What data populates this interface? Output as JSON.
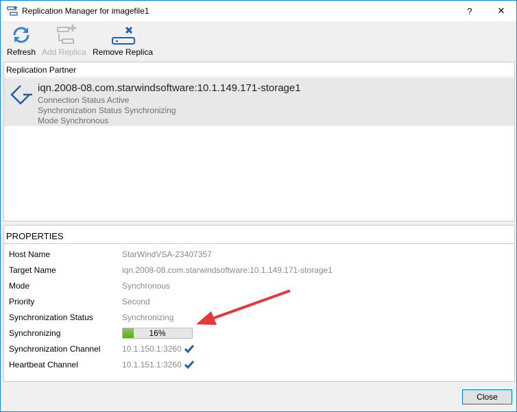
{
  "window": {
    "title": "Replication Manager for imagefile1",
    "help": "?",
    "close": "✕"
  },
  "toolbar": {
    "refresh": "Refresh",
    "add_replica": "Add Replica",
    "remove_replica": "Remove Replica"
  },
  "partners": {
    "header": "Replication Partner",
    "items": [
      {
        "name": "iqn.2008-08.com.starwindsoftware:10.1.149.171-storage1",
        "connection": "Connection Status Active",
        "sync": "Synchronization Status Synchronizing",
        "mode": "Mode Synchronous"
      }
    ]
  },
  "properties": {
    "title": "PROPERTIES",
    "rows": [
      {
        "k": "Host Name",
        "v": "StarWindVSA-23407357"
      },
      {
        "k": "Target Name",
        "v": "iqn.2008-08.com.starwindsoftware:10.1.149.171-storage1"
      },
      {
        "k": "Mode",
        "v": "Synchronous"
      },
      {
        "k": "Priority",
        "v": "Second"
      },
      {
        "k": "Synchronization Status",
        "v": "Synchronizing"
      },
      {
        "k": "Synchronizing",
        "v": "16%",
        "progress": 16
      },
      {
        "k": "Synchronization Channel",
        "v": "10.1.150.1:3260"
      },
      {
        "k": "Heartbeat Channel",
        "v": "10.1.151.1:3260"
      }
    ]
  },
  "footer": {
    "close": "Close"
  },
  "colors": {
    "accent": "#1e5fb4",
    "arrow": "#e8373a",
    "progress": "#6cb82c"
  }
}
